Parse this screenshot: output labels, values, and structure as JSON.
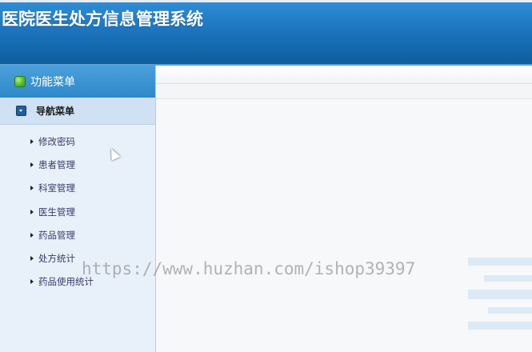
{
  "header": {
    "title": "医院医生处方信息管理系统"
  },
  "sidebar": {
    "panel_title": "功能菜单",
    "panel_icon": "cube-icon",
    "nav_title": "导航菜单",
    "nav_icon": "collapse-icon",
    "items": [
      {
        "label": "修改密码"
      },
      {
        "label": "患者管理"
      },
      {
        "label": "科室管理"
      },
      {
        "label": "医生管理"
      },
      {
        "label": "药品管理"
      },
      {
        "label": "处方统计"
      },
      {
        "label": "药品使用统计"
      }
    ]
  },
  "watermark": {
    "text": "https://www.huzhan.com/ishop39397"
  },
  "colors": {
    "header_top": "#2f8fd8",
    "header_bottom": "#0f5d9c",
    "sidebar_bg": "#e8f1fa",
    "panel_head": "#3a94d2",
    "nav_head": "#cfe1f3",
    "menu_text": "#3a3a6a"
  }
}
